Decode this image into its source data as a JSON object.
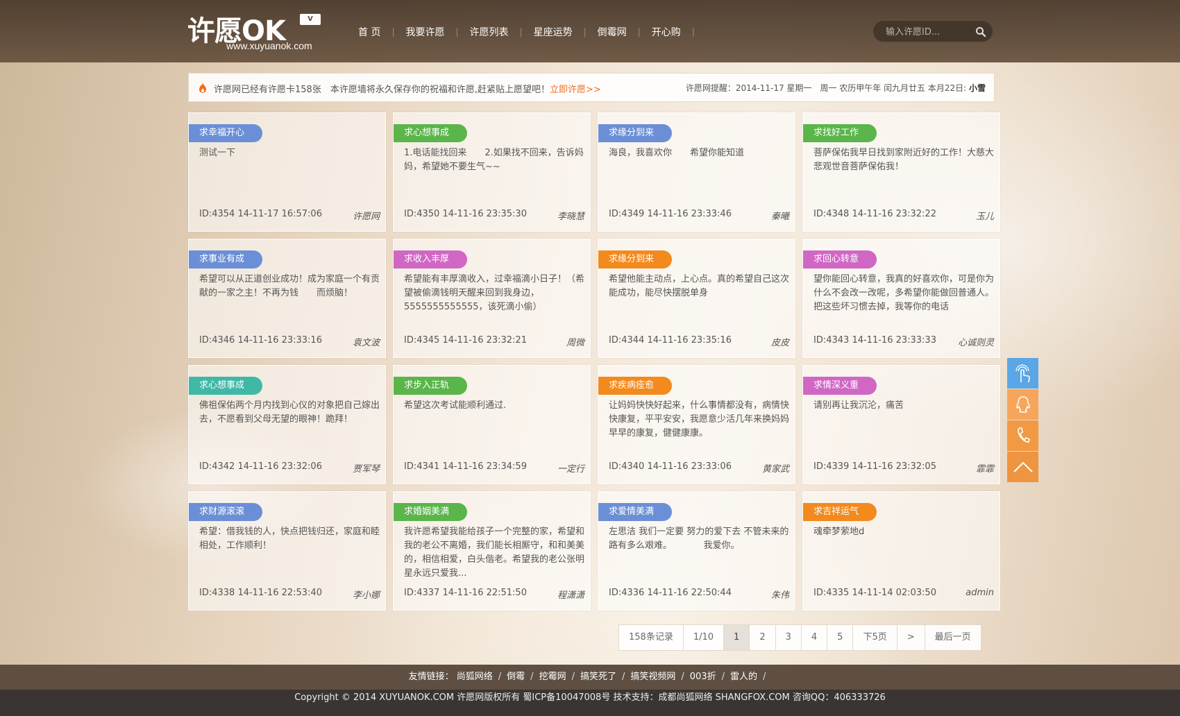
{
  "header": {
    "logo_text": "许愿OK",
    "logo_badge": "V",
    "logo_url": "www.xuyuanok.com",
    "nav": [
      {
        "label": "首 页"
      },
      {
        "label": "我要许愿"
      },
      {
        "label": "许愿列表"
      },
      {
        "label": "星座运势"
      },
      {
        "label": "倒霉网"
      },
      {
        "label": "开心购"
      }
    ],
    "search_placeholder": "输入许愿ID..."
  },
  "notice": {
    "text": "许愿网已经有许愿卡158张　本许愿墙将永久保存你的祝福和许愿,赶紧贴上愿望吧！",
    "link": "立即许愿>>",
    "right_prefix": "许愿网提醒：2014-11-17 星期一　周一 农历甲午年 闰九月廿五 本月22日: ",
    "right_weather": "小雪"
  },
  "cards": [
    {
      "tag": "求幸福开心",
      "color": "#6b8fd6",
      "text": "测试一下",
      "id": "ID:4354",
      "time": "14-11-17 16:57:06",
      "author": "许愿网"
    },
    {
      "tag": "求心想事成",
      "color": "#5ab54b",
      "text": "1.电话能找回来　　2.如果找不回来，告诉妈妈，希望她不要生气~~",
      "id": "ID:4350",
      "time": "14-11-16 23:35:30",
      "author": "李晓慧"
    },
    {
      "tag": "求缘分到来",
      "color": "#6b8fd6",
      "text": "海良，我喜欢你　　希望你能知道",
      "id": "ID:4349",
      "time": "14-11-16 23:33:46",
      "author": "秦曦"
    },
    {
      "tag": "求找好工作",
      "color": "#5ab54b",
      "text": "菩萨保佑我早日找到家附近好的工作！大慈大悲观世音菩萨保佑我！",
      "id": "ID:4348",
      "time": "14-11-16 23:32:22",
      "author": "玉儿"
    },
    {
      "tag": "求事业有成",
      "color": "#6b8fd6",
      "text": "希望可以从正道创业成功！成为家庭一个有贡献的一家之主！不再为钱　　而烦脑！",
      "id": "ID:4346",
      "time": "14-11-16 23:33:16",
      "author": "袁文波"
    },
    {
      "tag": "求收入丰厚",
      "color": "#d067c4",
      "text": "希望能有丰厚滴收入，过幸福滴小日子！（希望被偷滴钱明天醒来回到我身边，5555555555555，该死滴小偷）",
      "id": "ID:4345",
      "time": "14-11-16 23:32:21",
      "author": "周微"
    },
    {
      "tag": "求缘分到来",
      "color": "#f28a1d",
      "text": "希望他能主动点，上心点。真的希望自己这次能成功，能尽快摆脱单身",
      "id": "ID:4344",
      "time": "14-11-16 23:35:16",
      "author": "皮皮"
    },
    {
      "tag": "求回心转意",
      "color": "#d067c4",
      "text": "望你能回心转意，我真的好喜欢你，可是你为什么不会改一改呢，多希望你能做回普通人。把这些坏习惯去掉，我等你的电话",
      "id": "ID:4343",
      "time": "14-11-16 23:33:33",
      "author": "心诚则灵"
    },
    {
      "tag": "求心想事成",
      "color": "#3fb8a6",
      "text": "佛祖保佑两个月内找到心仪的对象把自己嫁出去，不愿看到父母无望的眼神！跪拜！",
      "id": "ID:4342",
      "time": "14-11-16 23:32:06",
      "author": "贾军琴"
    },
    {
      "tag": "求步入正轨",
      "color": "#5ab54b",
      "text": "希望这次考试能顺利通过.",
      "id": "ID:4341",
      "time": "14-11-16 23:34:59",
      "author": "一定行"
    },
    {
      "tag": "求疾病痊愈",
      "color": "#f28a1d",
      "text": "让妈妈快快好起来，什么事情都没有，病情快快康复，平平安安，我愿意少活几年来换妈妈早早的康复，健健康康。",
      "id": "ID:4340",
      "time": "14-11-16 23:33:06",
      "author": "黄家武"
    },
    {
      "tag": "求情深义重",
      "color": "#d067c4",
      "text": "请别再让我沉沦，痛苦",
      "id": "ID:4339",
      "time": "14-11-16 23:32:05",
      "author": "霏霏"
    },
    {
      "tag": "求财源滚滚",
      "color": "#6b8fd6",
      "text": "希望：借我钱的人，快点把钱归还，家庭和睦相处，工作顺利！",
      "id": "ID:4338",
      "time": "14-11-16 22:53:40",
      "author": "李小娜"
    },
    {
      "tag": "求婚姻美满",
      "color": "#5ab54b",
      "text": "我许愿希望我能给孩子一个完整的家，希望和我的老公不离婚，我们能长相厮守，和和美美的，相信相爱，白头偕老。希望我的老公张明星永远只爱我...",
      "id": "ID:4337",
      "time": "14-11-16 22:51:50",
      "author": "程潇潇"
    },
    {
      "tag": "求爱情美满",
      "color": "#6b8fd6",
      "text": "左思洁 我们一定要 努力的爱下去 不管未来的路有多么艰难。　　　　我爱你。",
      "id": "ID:4336",
      "time": "14-11-16 22:50:44",
      "author": "朱伟"
    },
    {
      "tag": "求吉祥运气",
      "color": "#f28a1d",
      "text": "魂牵梦萦地d",
      "id": "ID:4335",
      "time": "14-11-14 02:03:50",
      "author": "admin"
    }
  ],
  "pager": {
    "records": "158条记录",
    "pages": "1/10",
    "current": "1",
    "nums": [
      "2",
      "3",
      "4",
      "5"
    ],
    "next5": "下5页",
    "next": ">",
    "last": "最后一页"
  },
  "float_bar": [
    {
      "icon": "touch-icon",
      "color": "#5aa6e6"
    },
    {
      "icon": "qq-icon",
      "color": "#f6a55a"
    },
    {
      "icon": "phone-icon",
      "color": "#f19a43"
    },
    {
      "icon": "arrow-up-icon",
      "color": "#ef9440"
    }
  ],
  "footer": {
    "links_title": "友情链接：",
    "links": [
      "尚狐网络",
      "倒霉",
      "挖霉网",
      "搞笑死了",
      "搞笑视频网",
      "003折",
      "雷人的"
    ],
    "copyright": "Copyright © 2014 XUYUANOK.COM 许愿网版权所有 蜀ICP备10047008号  技术支持：成都尚狐网络 SHANGFOX.COM  咨询QQ：406333726"
  }
}
